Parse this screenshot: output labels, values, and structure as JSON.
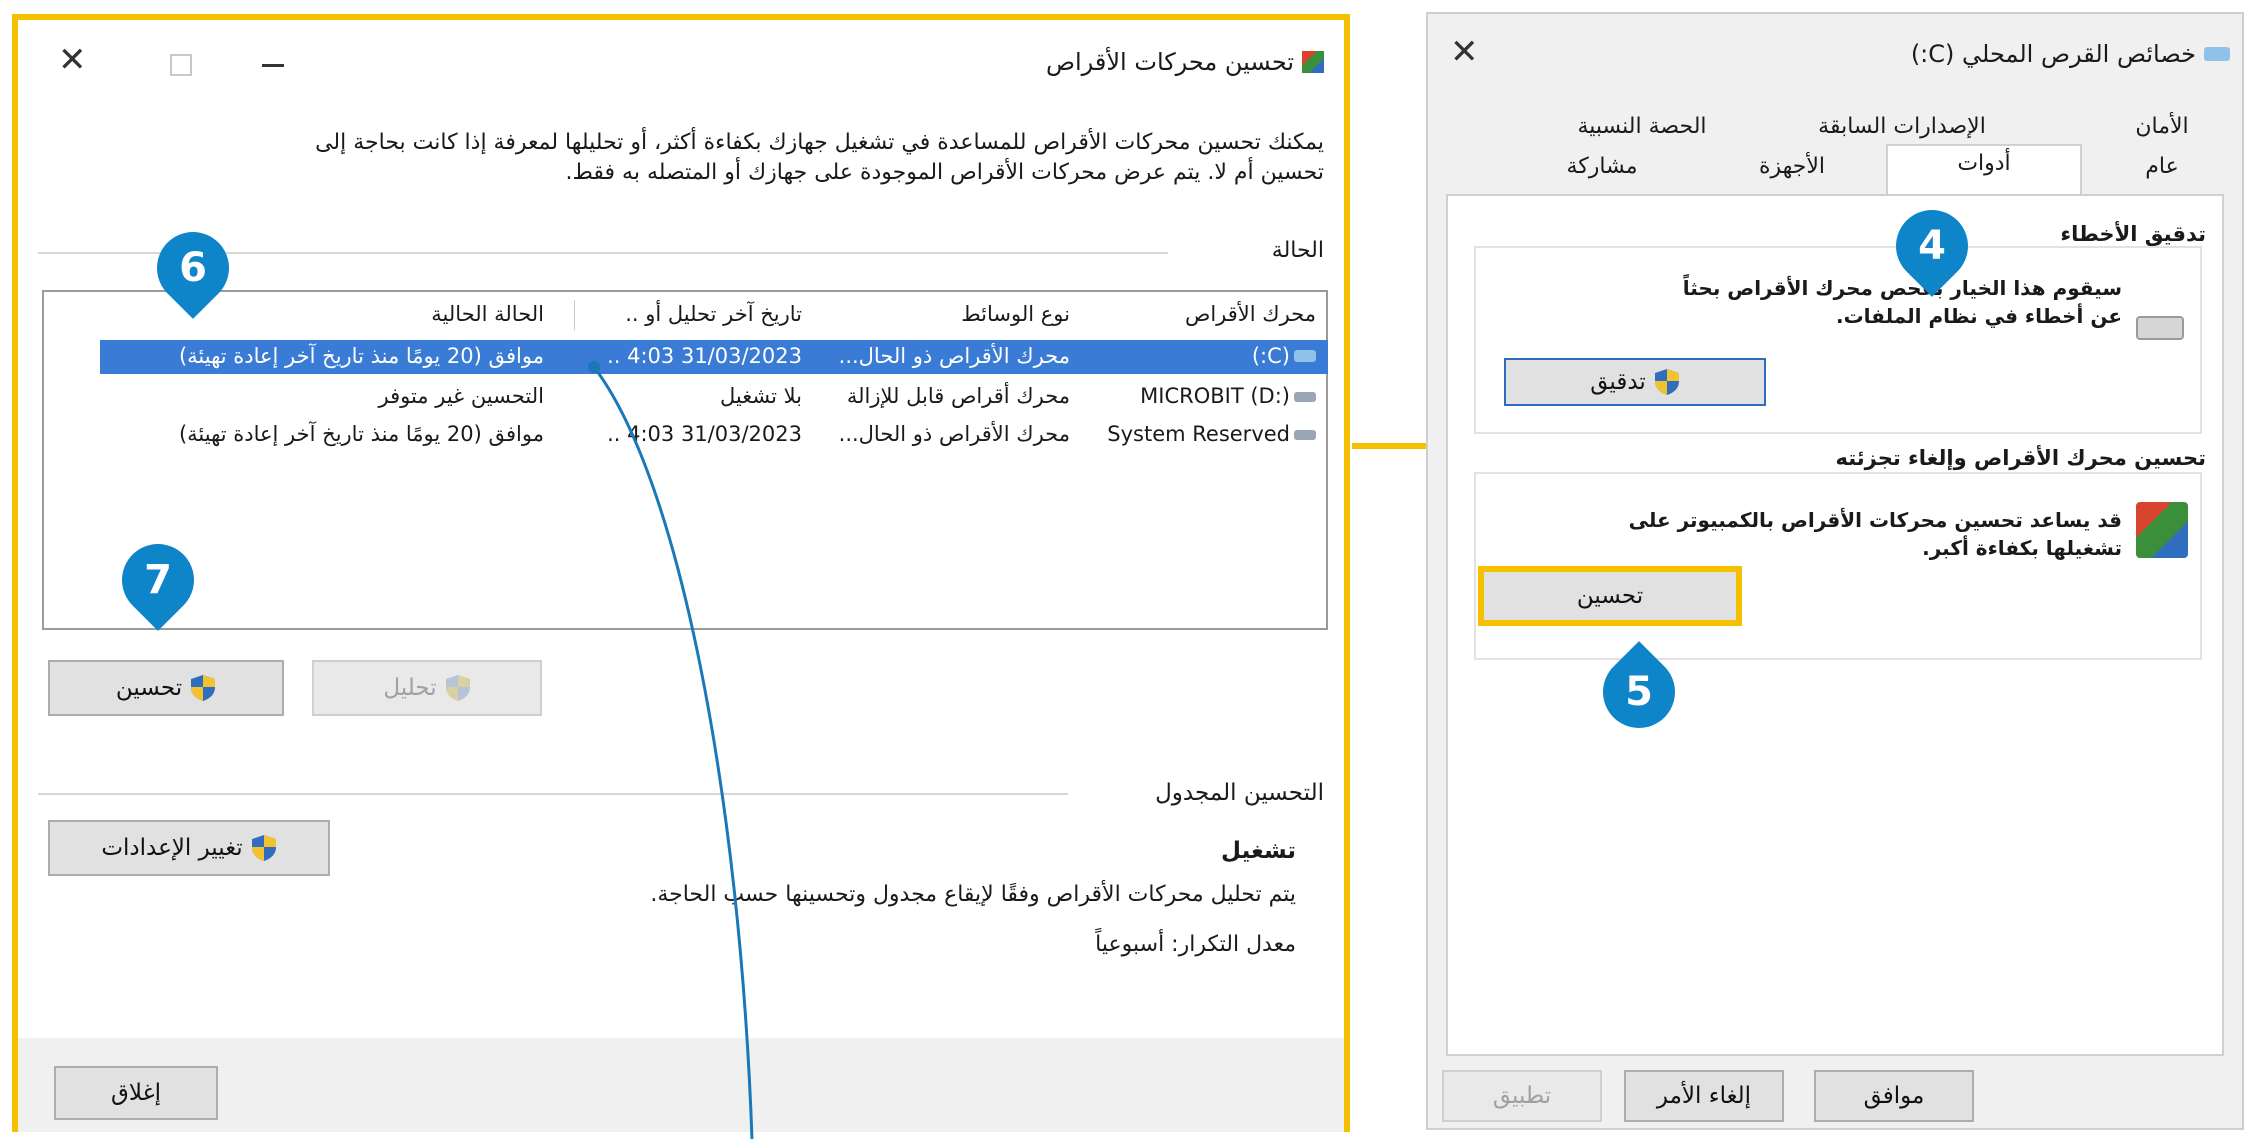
{
  "defrag": {
    "title": "تحسين محركات الأقراص",
    "description_line1": "يمكنك تحسين محركات الأقراص للمساعدة في تشغيل جهازك بكفاءة أكثر، أو تحليلها لمعرفة إذا كانت بحاجة إلى",
    "description_line2": "تحسين أم لا. يتم عرض محركات الأقراص الموجودة على جهازك أو المتصله به فقط.",
    "status_heading": "الحالة",
    "columns": [
      "محرك الأقراص",
      "نوع الوسائط",
      "تاريخ آخر تحليل أو ..",
      "الحالة الحالية"
    ],
    "rows": [
      {
        "drive": "(C:)",
        "media": "محرك الأقراص ذو الحال...",
        "date": "31/03/2023 4:03 ..",
        "status": "موافق (20 يومًا منذ تاريخ آخر إعادة تهيئة)"
      },
      {
        "drive": "MICROBIT (D:)",
        "media": "محرك أقراص قابل للإزالة",
        "date": "بلا تشغيل",
        "status": "التحسين غير متوفر"
      },
      {
        "drive": "System Reserved",
        "media": "محرك الأقراص ذو الحال...",
        "date": "31/03/2023 4:03 ..",
        "status": "موافق (20 يومًا منذ تاريخ آخر إعادة تهيئة)"
      }
    ],
    "analyze_label": "تحليل",
    "optimize_label": "تحسين",
    "scheduled_heading": "التحسين المجدول",
    "change_settings_label": "تغيير الإعدادات",
    "schedule_state": "تشغيل",
    "schedule_desc": "يتم تحليل محركات الأقراص وفقًا لإيقاع مجدول وتحسينها حسب الحاجة.",
    "frequency": "معدل التكرار: أسبوعياً",
    "close_label": "إغلاق"
  },
  "props": {
    "title": "خصائص القرص المحلي (C:)",
    "tabs_row1": [
      "الأمان",
      "الإصدارات السابقة",
      "الحصة النسبية"
    ],
    "tabs_row2": [
      "عام",
      "أدوات",
      "الأجهزة",
      "مشاركة"
    ],
    "error_check_heading": "تدقيق الأخطاء",
    "error_check_text1": "سيقوم هذا الخيار بفحص محرك الأقراص بحثاً",
    "error_check_text2": "عن أخطاء في نظام الملفات.",
    "check_label": "تدقيق",
    "optimize_heading": "تحسين محرك الأقراص وإلغاء تجزئته",
    "optimize_text1": "قد يساعد تحسين محركات الأقراص بالكمبيوتر على",
    "optimize_text2": "تشغيلها بكفاءة أكبر.",
    "optimize_label": "تحسين",
    "ok_label": "موافق",
    "cancel_label": "إلغاء الأمر",
    "apply_label": "تطبيق"
  },
  "callouts": {
    "c4": "4",
    "c5": "5",
    "c6": "6",
    "c7": "7"
  },
  "colors": {
    "highlight": "#f5c000",
    "callout": "#0f85c9",
    "selection": "#3a7bd5",
    "connector": "#1b78b8"
  }
}
